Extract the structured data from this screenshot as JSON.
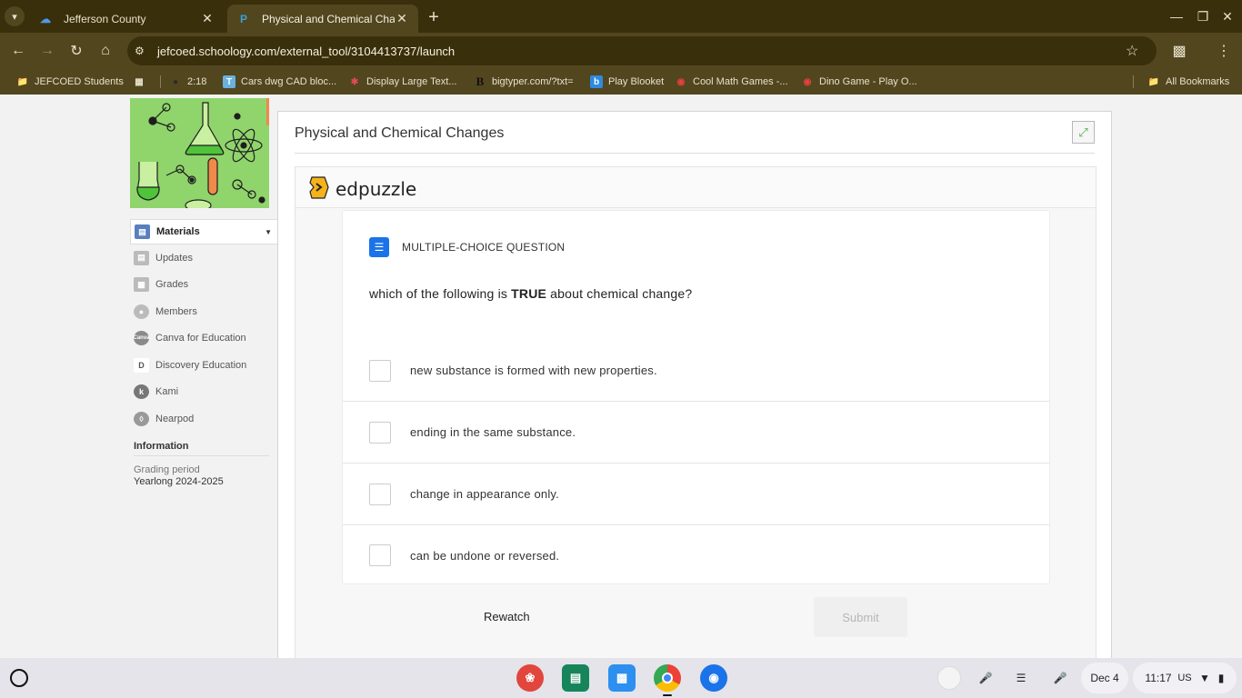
{
  "browser": {
    "tabs": [
      {
        "title": "Jefferson County",
        "active": false
      },
      {
        "title": "Physical and Chemical Chang",
        "active": true
      }
    ],
    "url": "jefcoed.schoology.com/external_tool/3104413737/launch",
    "bookmarks": [
      "JEFCOED Students",
      "2:18",
      "Cars dwg CAD bloc...",
      "Display Large Text...",
      "bigtyper.com/?txt=",
      "Play Blooket",
      "Cool Math Games -...",
      "Dino Game - Play O..."
    ],
    "all_bookmarks": "All Bookmarks"
  },
  "sidebar": {
    "items": [
      {
        "label": "Materials",
        "icon": "materials-icon"
      },
      {
        "label": "Updates",
        "icon": "updates-icon"
      },
      {
        "label": "Grades",
        "icon": "grades-icon"
      },
      {
        "label": "Members",
        "icon": "members-icon"
      },
      {
        "label": "Canva for Education",
        "icon": "canva-icon"
      },
      {
        "label": "Discovery Education",
        "icon": "discovery-icon"
      },
      {
        "label": "Kami",
        "icon": "kami-icon"
      },
      {
        "label": "Nearpod",
        "icon": "nearpod-icon"
      }
    ],
    "info_heading": "Information",
    "grading_period_label": "Grading period",
    "grading_period_value": "Yearlong 2024-2025"
  },
  "content": {
    "title": "Physical and Chemical Changes",
    "brand": "edpuzzle",
    "question": {
      "type": "MULTIPLE-CHOICE QUESTION",
      "text_before": "which of the following is ",
      "text_emphasis": "TRUE",
      "text_after": " about chemical change?",
      "options": [
        "new substance is formed with new properties.",
        "ending in the same substance.",
        "change in appearance only.",
        "can be undone or reversed."
      ]
    },
    "rewatch_label": "Rewatch",
    "submit_label": "Submit"
  },
  "shelf": {
    "date": "Dec 4",
    "time": "11:17",
    "locale": "US"
  }
}
